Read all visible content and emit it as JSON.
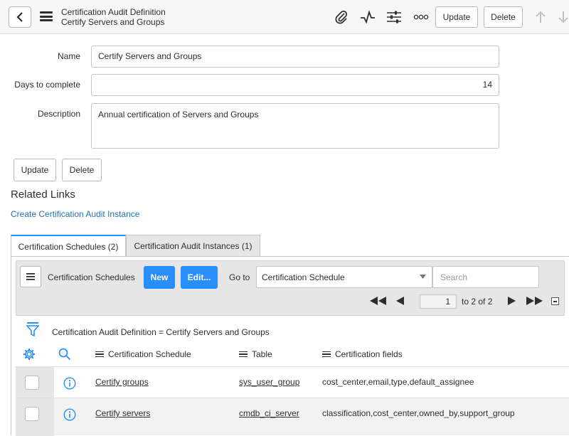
{
  "header": {
    "title": "Certification Audit Definition",
    "subtitle": "Certify Servers and Groups",
    "update_label": "Update",
    "delete_label": "Delete"
  },
  "form": {
    "name_label": "Name",
    "name_value": "Certify Servers and Groups",
    "days_label": "Days to complete",
    "days_value": "14",
    "description_label": "Description",
    "description_value": "Annual certification of Servers and Groups",
    "update_label": "Update",
    "delete_label": "Delete"
  },
  "related_links": {
    "title": "Related Links",
    "link": "Create Certification Audit Instance"
  },
  "tabs": [
    {
      "label": "Certification Schedules (2)",
      "active": true
    },
    {
      "label": "Certification Audit Instances (1)",
      "active": false
    }
  ],
  "list": {
    "title": "Certification Schedules",
    "new_label": "New",
    "edit_label": "Edit...",
    "goto_label": "Go to",
    "goto_select": "Certification Schedule",
    "search_placeholder": "Search",
    "page_value": "1",
    "page_total": "to 2 of 2",
    "filter": "Certification Audit Definition = Certify Servers and Groups",
    "columns": [
      "Certification Schedule",
      "Table",
      "Certification fields"
    ],
    "rows": [
      {
        "schedule": "Certify groups",
        "table": "sys_user_group",
        "fields": "cost_center,email,type,default_assignee"
      },
      {
        "schedule": "Certify servers",
        "table": "cmdb_ci_server",
        "fields": "classification,cost_center,owned_by,support_group"
      }
    ]
  },
  "colors": {
    "accent": "#278efc",
    "link": "#1f6fb5",
    "toolbar": "#e6e6e6"
  }
}
